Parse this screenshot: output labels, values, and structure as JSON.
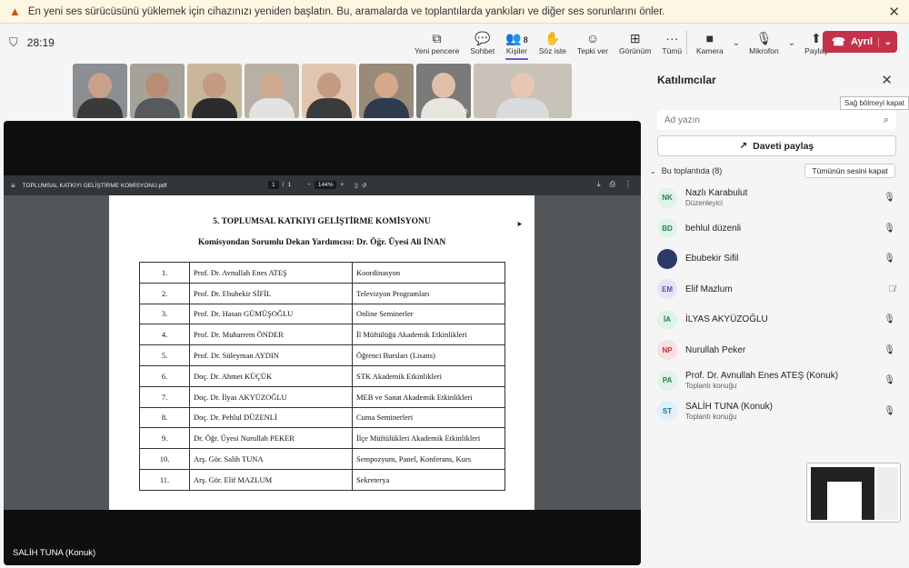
{
  "banner": {
    "message": "En yeni ses sürücüsünü yüklemek için cihazınızı yeniden başlatın. Bu, aramalarda ve toplantılarda yankıları ve diğer ses sorunlarını önler."
  },
  "timer": "28:19",
  "toolbar": {
    "new_window": "Yeni pencere",
    "chat": "Sohbet",
    "people": "Kişiler",
    "people_count": "8",
    "raise_hand": "Söz iste",
    "react": "Tepki ver",
    "view": "Görünüm",
    "more": "Tümü",
    "camera": "Kamera",
    "mic": "Mikrofon",
    "share": "Paylaş",
    "leave": "Ayrıl"
  },
  "pdf": {
    "filename": "TOPLUMSAL KATKIYI GELİŞTİRME KOMİSYONU.pdf",
    "page_current": "1",
    "page_sep": "/",
    "page_total": "1",
    "zoom": "144%",
    "title": "5. TOPLUMSAL KATKIYI GELİŞTİRME KOMİSYONU",
    "subtitle": "Komisyondan Sorumlu Dekan Yardımcısı: Dr. Öğr. Üyesi Ali İNAN",
    "rows": [
      {
        "no": "1.",
        "person": "Prof. Dr. Avnullah Enes ATEŞ",
        "role": "Koordinasyon"
      },
      {
        "no": "2.",
        "person": "Prof. Dr. Ebubekir SİFİL",
        "role": "Televizyon Programları"
      },
      {
        "no": "3.",
        "person": "Prof. Dr. Hasan GÜMÜŞOĞLU",
        "role": "Online Seminerler"
      },
      {
        "no": "4.",
        "person": "Prof. Dr. Muharrem ÖNDER",
        "role": "İl Müftülüğü Akademik Etkinlikleri"
      },
      {
        "no": "5.",
        "person": "Prof. Dr. Süleyman AYDIN",
        "role": "Öğrenci Bursları (Lisans)"
      },
      {
        "no": "6.",
        "person": "Doç. Dr. Ahmet KÜÇÜK",
        "role": "STK Akademik Etkinlikleri"
      },
      {
        "no": "7.",
        "person": "Doç. Dr. İlyas AKYÜZOĞLU",
        "role": "MEB ve Sanat Akademik Etkinlikleri"
      },
      {
        "no": "8.",
        "person": "Doç. Dr. Pehlul DÜZENLİ",
        "role": "Cuma Seminerleri"
      },
      {
        "no": "9.",
        "person": "Dr. Öğr. Üyesi Nurullah PEKER",
        "role": "İlçe Müftülükleri Akademik Etkinlikleri"
      },
      {
        "no": "10.",
        "person": "Arş. Gör. Salih TUNA",
        "role": "Sempozyum, Panel, Konferans, Kurs"
      },
      {
        "no": "11.",
        "person": "Arş. Gör. Elif MAZLUM",
        "role": "Sekreterya"
      }
    ]
  },
  "stage_name": "SALİH TUNA (Konuk)",
  "panel": {
    "title": "Katılımcılar",
    "tooltip": "Sağ bölmeyi kapat",
    "search_placeholder": "Ad yazın",
    "invite": "Daveti paylaş",
    "section": "Bu toplantıda (8)",
    "mute_all": "Tümünün sesini kapat",
    "participants": [
      {
        "initials": "NK",
        "name": "Nazlı Karabulut",
        "role": "Düzenleyici",
        "bg": "#dff3e8",
        "fg": "#2e7d4f",
        "mic": "on"
      },
      {
        "initials": "BD",
        "name": "behlul düzenli",
        "role": "",
        "bg": "#dff3e8",
        "fg": "#2e7d4f",
        "mic": "on"
      },
      {
        "initials": "",
        "name": "Ebubekir Sifil",
        "role": "",
        "bg": "#2b3a67",
        "fg": "#ffffff",
        "mic": "on"
      },
      {
        "initials": "EM",
        "name": "Elif Mazlum",
        "role": "",
        "bg": "#e6e3f5",
        "fg": "#5b4ea8",
        "mic": "off"
      },
      {
        "initials": "İA",
        "name": "İLYAS AKYÜZOĞLU",
        "role": "",
        "bg": "#dff3e8",
        "fg": "#2e7d4f",
        "mic": "on"
      },
      {
        "initials": "NP",
        "name": "Nurullah Peker",
        "role": "",
        "bg": "#f9e0e0",
        "fg": "#b03a3a",
        "mic": "on"
      },
      {
        "initials": "PA",
        "name": "Prof. Dr. Avnullah Enes ATEŞ (Konuk)",
        "role": "Toplantı konuğu",
        "bg": "#dff3e8",
        "fg": "#2e7d4f",
        "mic": "on"
      },
      {
        "initials": "ST",
        "name": "SALİH TUNA (Konuk)",
        "role": "Toplantı konuğu",
        "bg": "#dff0f8",
        "fg": "#1f6f9a",
        "mic": "on"
      }
    ]
  },
  "thumbnails": [
    {
      "skin": "#c9a08a",
      "shirt": "#3a3a3a",
      "bg": "#8a8f94",
      "muted": false
    },
    {
      "skin": "#b88d73",
      "shirt": "#565a5e",
      "bg": "#a5a29a",
      "muted": false
    },
    {
      "skin": "#c49a80",
      "shirt": "#2b2b2b",
      "bg": "#c8b79a",
      "muted": false
    },
    {
      "skin": "#d1a890",
      "shirt": "#e2e2e2",
      "bg": "#b8b0a4",
      "muted": false
    },
    {
      "skin": "#c39a82",
      "shirt": "#3b3b3b",
      "bg": "#e0c6b0",
      "muted": false
    },
    {
      "skin": "#d4a98a",
      "shirt": "#2d3b4f",
      "bg": "#9a8a7a",
      "muted": false
    },
    {
      "skin": "#e0c0a8",
      "shirt": "#e8e4de",
      "bg": "#7a7a78",
      "muted": true
    },
    {
      "skin": "#e6c8b2",
      "shirt": "#d9dadc",
      "bg": "#c9c2b8",
      "muted": false
    }
  ]
}
